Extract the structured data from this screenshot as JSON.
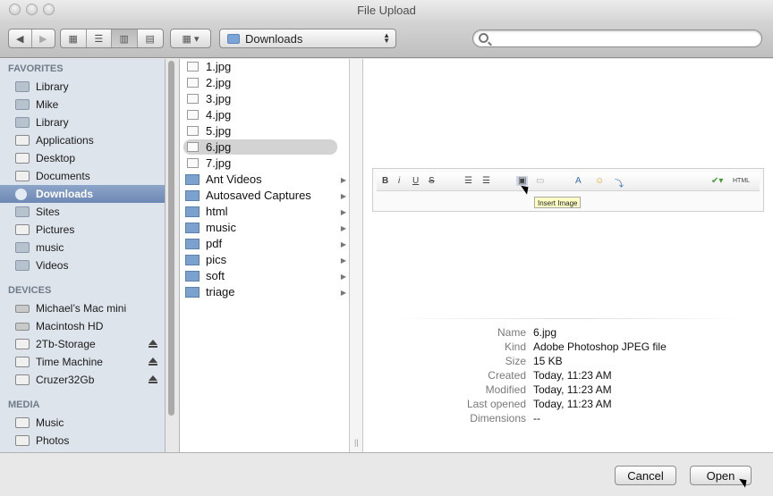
{
  "window": {
    "title": "File Upload"
  },
  "toolbar": {
    "back_icon": "back-arrow-icon",
    "forward_icon": "forward-arrow-icon",
    "location": "Downloads",
    "search": {
      "value": "",
      "placeholder": ""
    }
  },
  "sidebar": {
    "sections": [
      {
        "header": "FAVORITES",
        "items": [
          {
            "label": "Library"
          },
          {
            "label": "Mike"
          },
          {
            "label": "Library"
          },
          {
            "label": "Applications"
          },
          {
            "label": "Desktop"
          },
          {
            "label": "Documents"
          },
          {
            "label": "Downloads",
            "selected": true
          },
          {
            "label": "Sites"
          },
          {
            "label": "Pictures"
          },
          {
            "label": "music"
          },
          {
            "label": "Videos"
          }
        ]
      },
      {
        "header": "DEVICES",
        "items": [
          {
            "label": "Michael’s Mac mini"
          },
          {
            "label": "Macintosh HD"
          },
          {
            "label": "2Tb-Storage",
            "eject": true
          },
          {
            "label": "Time Machine",
            "eject": true
          },
          {
            "label": "Cruzer32Gb",
            "eject": true
          }
        ]
      },
      {
        "header": "MEDIA",
        "items": [
          {
            "label": "Music"
          },
          {
            "label": "Photos"
          }
        ]
      }
    ]
  },
  "files": [
    {
      "name": "1.jpg",
      "type": "image"
    },
    {
      "name": "2.jpg",
      "type": "image"
    },
    {
      "name": "3.jpg",
      "type": "image"
    },
    {
      "name": "4.jpg",
      "type": "image"
    },
    {
      "name": "5.jpg",
      "type": "image"
    },
    {
      "name": "6.jpg",
      "type": "image",
      "selected": true
    },
    {
      "name": "7.jpg",
      "type": "image"
    },
    {
      "name": "Ant Videos",
      "type": "folder"
    },
    {
      "name": "Autosaved Captures",
      "type": "folder"
    },
    {
      "name": "html",
      "type": "folder"
    },
    {
      "name": "music",
      "type": "folder"
    },
    {
      "name": "pdf",
      "type": "folder"
    },
    {
      "name": "pics",
      "type": "folder"
    },
    {
      "name": "soft",
      "type": "folder"
    },
    {
      "name": "triage",
      "type": "folder"
    }
  ],
  "preview": {
    "tooltip": "Insert Image",
    "info": [
      {
        "key": "Name",
        "value": "6.jpg"
      },
      {
        "key": "Kind",
        "value": "Adobe Photoshop JPEG file"
      },
      {
        "key": "Size",
        "value": "15 KB"
      },
      {
        "key": "Created",
        "value": "Today, 11:23 AM"
      },
      {
        "key": "Modified",
        "value": "Today, 11:23 AM"
      },
      {
        "key": "Last opened",
        "value": "Today, 11:23 AM"
      },
      {
        "key": "Dimensions",
        "value": "--"
      }
    ],
    "editor_buttons": [
      "B",
      "i",
      "U",
      "S",
      "HTML"
    ]
  },
  "buttons": {
    "cancel": "Cancel",
    "open": "Open"
  }
}
